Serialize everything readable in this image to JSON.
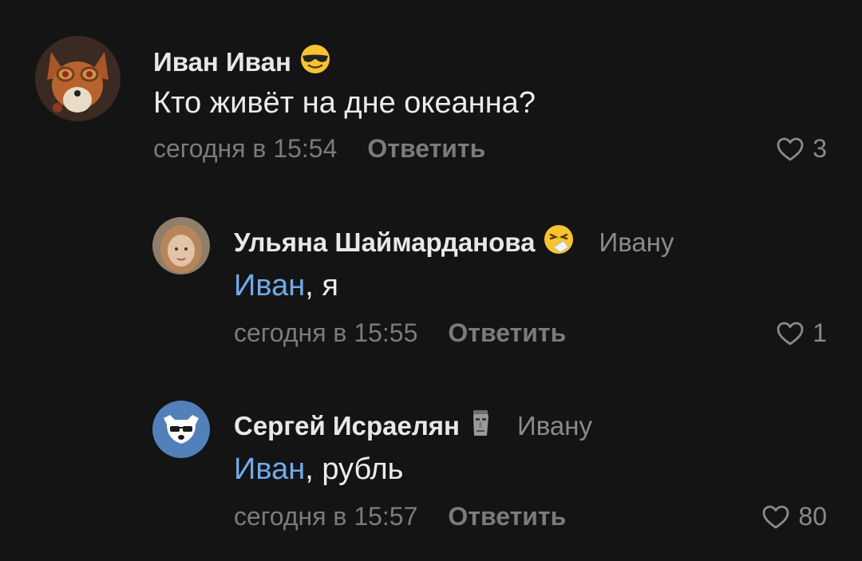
{
  "comments": [
    {
      "author": "Иван Иван",
      "author_emoji": "sunglasses-emoji",
      "text": "Кто живёт на дне океанна?",
      "time": "сегодня в 15:54",
      "reply_label": "Ответить",
      "likes": "3"
    },
    {
      "author": "Ульяна Шаймарданова",
      "author_emoji": "sneezing-face-emoji",
      "reply_to": "Ивану",
      "mention": "Иван",
      "text_rest": ", я",
      "time": "сегодня в 15:55",
      "reply_label": "Ответить",
      "likes": "1"
    },
    {
      "author": "Сергей Исраелян",
      "author_emoji": "moai-emoji",
      "reply_to": "Ивану",
      "mention": "Иван",
      "text_rest": ", рубль",
      "time": "сегодня в 15:57",
      "reply_label": "Ответить",
      "likes": "80"
    }
  ],
  "colors": {
    "background": "#141414",
    "mention": "#71aaeb",
    "secondary_text": "#7b7b7b",
    "vk_avatar_bg": "#5181b8"
  }
}
